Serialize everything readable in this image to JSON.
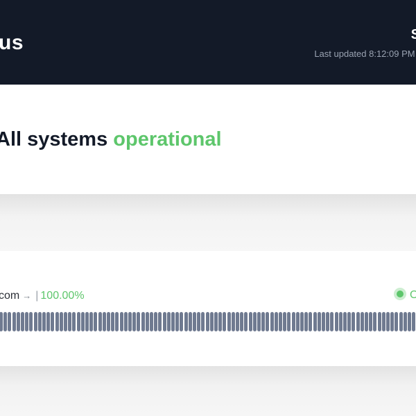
{
  "header": {
    "brand": "us",
    "link_label": "S",
    "last_updated": "Last updated 8:12:09 PM",
    "separator": "|"
  },
  "status": {
    "prefix": "All systems",
    "state": "operational"
  },
  "monitor": {
    "name": "com",
    "arrow": "→",
    "pipe": "|",
    "uptime": "100.00%",
    "status_label": "O",
    "bar_count": 100,
    "bar_color": "#6f7a90"
  },
  "colors": {
    "header_bg": "#131a28",
    "operational": "#5dc66b"
  }
}
